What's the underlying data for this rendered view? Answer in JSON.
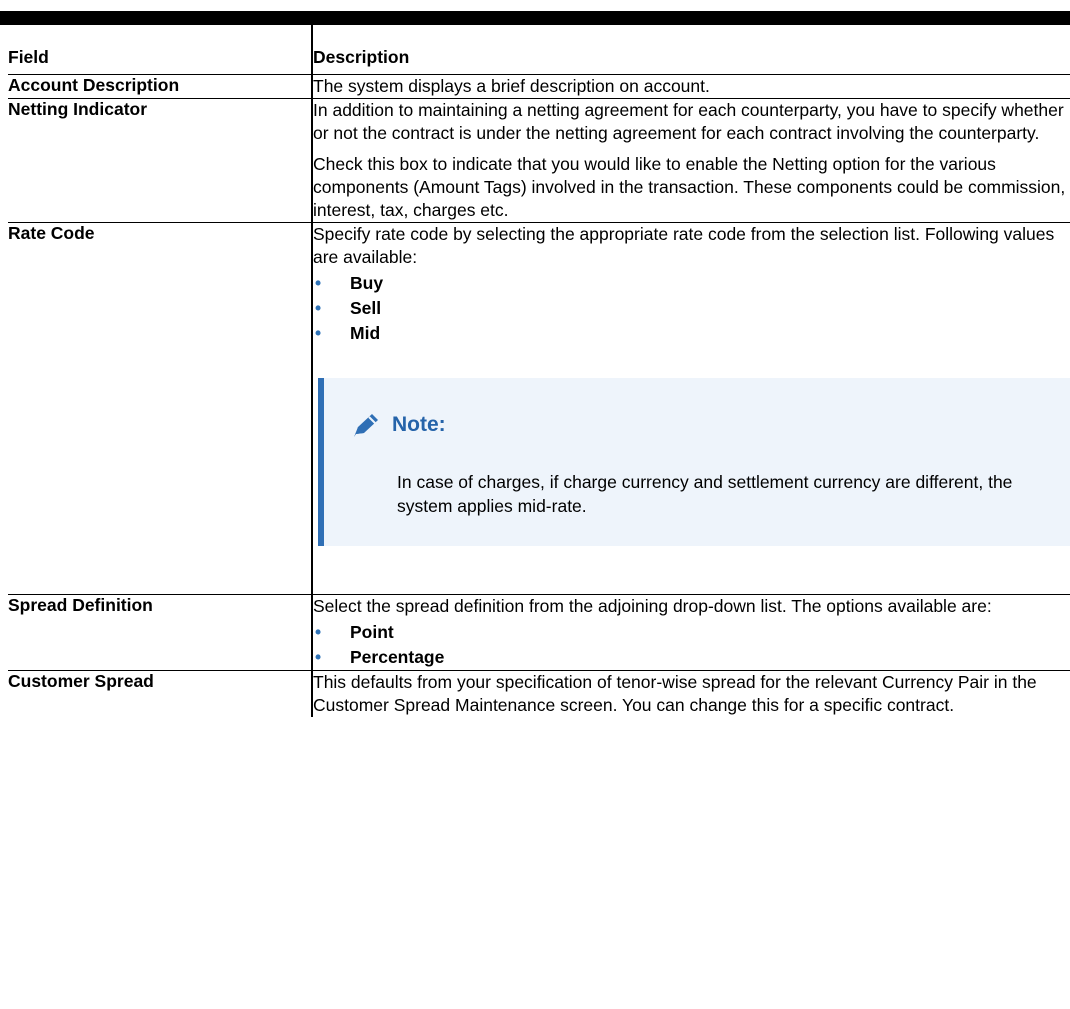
{
  "table": {
    "headers": {
      "field": "Field",
      "description": "Description"
    },
    "rows": {
      "account_description": {
        "field": "Account Description",
        "para1": "The system displays a brief description on account."
      },
      "netting_indicator": {
        "field": "Netting Indicator",
        "para1": "In addition to maintaining a netting agreement for each counterparty, you have to specify whether or not the contract is under the netting agreement for each contract involving the counterparty.",
        "para2": "Check this box to indicate that you would like to enable the Netting option for the various components (Amount Tags) involved in the transaction. These components could be commission, interest, tax, charges etc."
      },
      "rate_code": {
        "field": "Rate Code",
        "para1": "Specify rate code by selecting the appropriate rate code from the selection list. Following values are available:",
        "options": [
          "Buy",
          "Sell",
          "Mid"
        ],
        "note_title": "Note:",
        "note_text": "In case of charges, if charge currency and settlement currency are different, the system applies mid-rate."
      },
      "spread_definition": {
        "field": "Spread Definition",
        "para1": "Select the spread definition from the adjoining drop-down list. The options available are:",
        "options": [
          "Point",
          "Percentage"
        ]
      },
      "customer_spread": {
        "field": "Customer Spread",
        "para1": "This defaults from your specification of tenor-wise spread for the relevant Currency Pair in the Customer Spread Maintenance screen. You can change this for a specific contract."
      }
    }
  },
  "colors": {
    "note_accent": "#2f6fb5",
    "note_background": "#eef4fb",
    "bullet": "#2f73b8"
  },
  "icons": {
    "note": "pencil-icon"
  }
}
